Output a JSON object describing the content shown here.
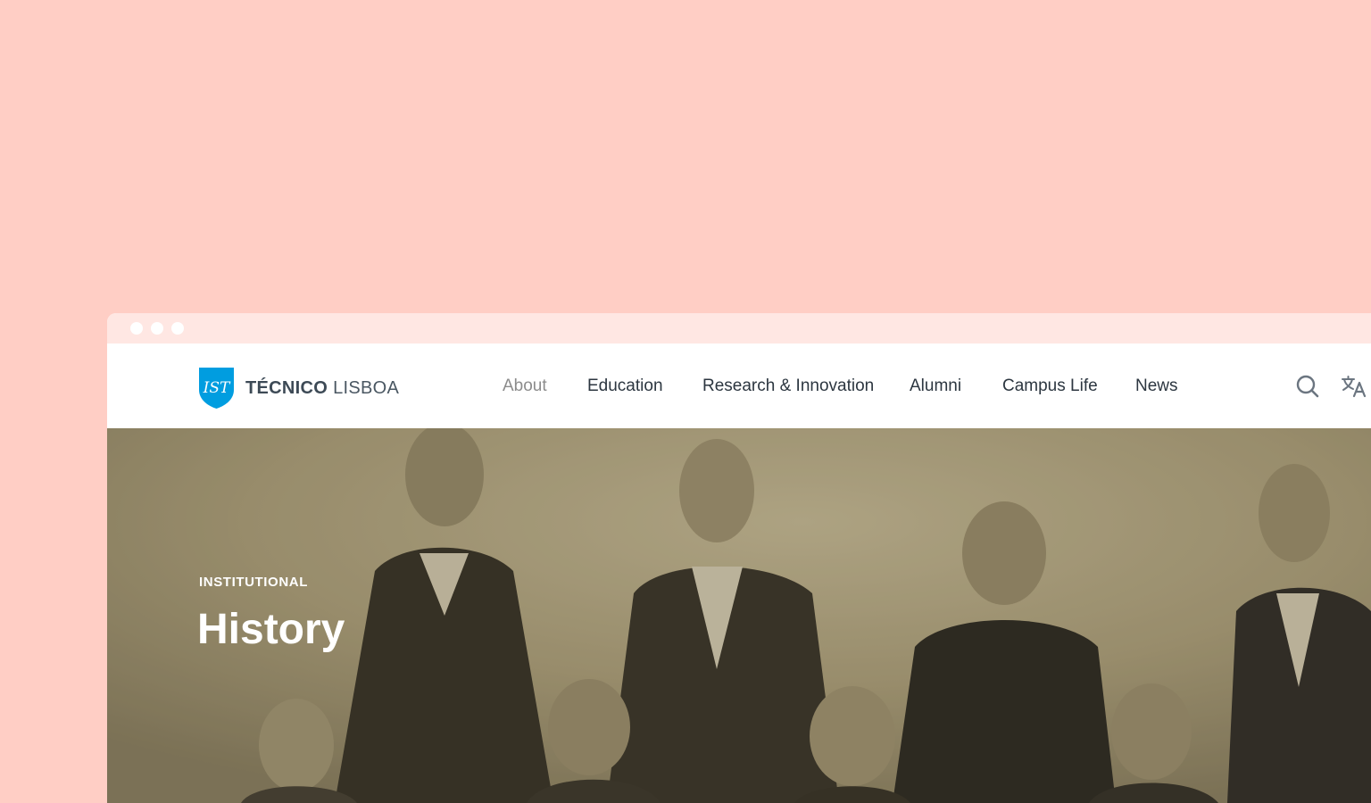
{
  "brand": {
    "name_bold": "TÉCNICO",
    "name_light": "LISBOA",
    "shield_letters": "IST",
    "accent_color": "#009de0"
  },
  "nav": {
    "items": [
      {
        "label": "About",
        "active": true
      },
      {
        "label": "Education",
        "active": false
      },
      {
        "label": "Research & Innovation",
        "active": false
      },
      {
        "label": "Alumni",
        "active": false
      },
      {
        "label": "Campus Life",
        "active": false
      },
      {
        "label": "News",
        "active": false
      }
    ],
    "icons": [
      "search-icon",
      "translate-icon"
    ]
  },
  "hero": {
    "kicker": "INSTITUTIONAL",
    "title": "History",
    "image": "sepia-group-portrait"
  },
  "colors": {
    "background": "#ffcec5",
    "titlebar": "#ffe7e3",
    "nav_text": "#2c3640",
    "nav_active": "#8c8c8c"
  }
}
